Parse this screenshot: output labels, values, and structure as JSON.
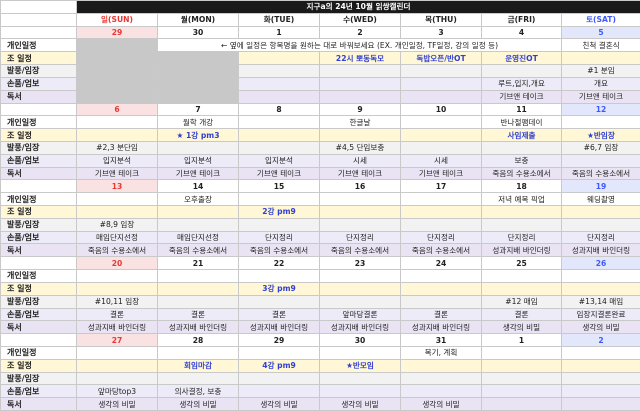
{
  "title": "지구a의 24년 10월 읽쌍캘린더",
  "day_headers": [
    "일(SUN)",
    "월(MON)",
    "화(TUE)",
    "수(WED)",
    "목(THU)",
    "금(FRI)",
    "토(SAT)"
  ],
  "row_labels": {
    "plan": "개인일정",
    "group": "조 일정",
    "announce": "발풍/임장",
    "library": "손품/엄보",
    "reading": "독서"
  },
  "weeks": [
    {
      "days": [
        "29",
        "30",
        "1",
        "2",
        "3",
        "4",
        "5"
      ],
      "plan": [
        "",
        "← 옆에 일정은 항목명을 원하는 대로 바꿔보세요 (EX. 개인일정, TF일정, 강의 일정 등)",
        "",
        "",
        "",
        "",
        "친척 결혼식"
      ],
      "group": [
        "",
        "",
        "",
        "22시 뽀동독모",
        "독밥오픈/반OT",
        "운영진OT",
        ""
      ],
      "announce": [
        "",
        "",
        "",
        "",
        "",
        "",
        "#1 분임"
      ],
      "library": [
        "",
        "",
        "",
        "",
        "",
        "루트,입지,개요",
        "개요"
      ],
      "reading": [
        "",
        "",
        "",
        "",
        "",
        "기브앤 테이크",
        "기브앤 테이크"
      ]
    },
    {
      "days": [
        "6",
        "7",
        "8",
        "9",
        "10",
        "11",
        "12"
      ],
      "plan": [
        "",
        "월학 개강",
        "",
        "한글날",
        "",
        "반나절팸데이",
        ""
      ],
      "group": [
        "",
        "★ 1강 pm3",
        "",
        "",
        "",
        "사임제출",
        "★반임장"
      ],
      "announce": [
        "#2,3 분단임",
        "",
        "",
        "#4,5 단임보충",
        "",
        "",
        "#6,7 임장"
      ],
      "library": [
        "입지분석",
        "입지분석",
        "입지분석",
        "시세",
        "시세",
        "보충",
        ""
      ],
      "reading": [
        "기브앤 테이크",
        "기브앤 테이크",
        "기브앤 테이크",
        "기브앤 테이크",
        "기브앤 테이크",
        "죽음의 수용소에서",
        "죽음의 수용소에서"
      ]
    },
    {
      "days": [
        "13",
        "14",
        "15",
        "16",
        "17",
        "18",
        "19"
      ],
      "plan": [
        "",
        "오후출장",
        "",
        "",
        "",
        "저녁 예복 픽업",
        "웨딩촬영"
      ],
      "group": [
        "",
        "",
        "2강 pm9",
        "",
        "",
        "",
        ""
      ],
      "announce": [
        "#8,9 임장",
        "",
        "",
        "",
        "",
        "",
        ""
      ],
      "library": [
        "매임단지선정",
        "매임단지선정",
        "단지정리",
        "단지정리",
        "단지정리",
        "단지정리",
        "단지정리"
      ],
      "reading": [
        "죽음의 수용소에서",
        "죽음의 수용소에서",
        "죽음의 수용소에서",
        "죽음의 수용소에서",
        "죽음의 수용소에서",
        "성과지배 바인더링",
        "성과지배 바인더링"
      ]
    },
    {
      "days": [
        "20",
        "21",
        "22",
        "23",
        "24",
        "25",
        "26"
      ],
      "plan": [
        "",
        "",
        "",
        "",
        "",
        "",
        ""
      ],
      "group": [
        "",
        "",
        "3강 pm9",
        "",
        "",
        "",
        ""
      ],
      "announce": [
        "#10,11 임장",
        "",
        "",
        "",
        "",
        "#12 매임",
        "#13,14 매임"
      ],
      "library": [
        "결론",
        "결론",
        "결론",
        "앞마당결론",
        "결론",
        "결론",
        "임장지결론완료"
      ],
      "reading": [
        "성과지배 바인더링",
        "성과지배 바인더링",
        "성과지배 바인더링",
        "성과지배 바인더링",
        "성과지배 바인더링",
        "생각의 비밀",
        "생각의 비밀"
      ]
    },
    {
      "days": [
        "27",
        "28",
        "29",
        "30",
        "31",
        "1",
        "2"
      ],
      "plan": [
        "",
        "",
        "",
        "",
        "복기, 계획",
        "",
        ""
      ],
      "group": [
        "",
        "회임마감",
        "4강 pm9",
        "★반모임",
        "",
        "",
        ""
      ],
      "announce": [
        "",
        "",
        "",
        "",
        "",
        "",
        ""
      ],
      "library": [
        "앞마당top3",
        "의사결정, 보충",
        "",
        "",
        "",
        "",
        ""
      ],
      "reading": [
        "생각의 비밀",
        "생각의 비밀",
        "생각의 비밀",
        "생각의 비밀",
        "생각의 비밀",
        "",
        ""
      ]
    }
  ],
  "colors": {
    "title_bg": "#1a1a1a",
    "sunday": "#e53935",
    "saturday": "#3d5afe",
    "group_row": "#fff7d6",
    "group_text": "#2f3fd0",
    "announce_row": "#f2f2f2",
    "library_row": "#ecebf7",
    "reading_row": "#e9e3f3",
    "inactive": "#c8c8c8"
  }
}
